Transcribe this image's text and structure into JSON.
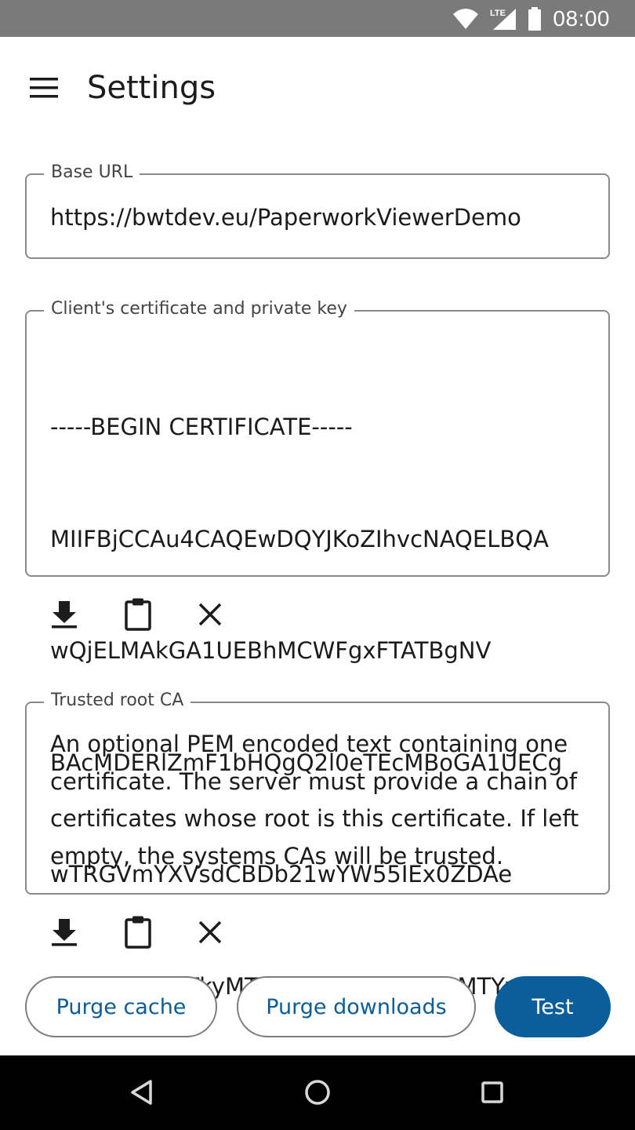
{
  "status_bar": {
    "time": "08:00",
    "icons": [
      "wifi-icon",
      "lte-signal-icon",
      "battery-icon"
    ],
    "lte_label": "LTE"
  },
  "app_bar": {
    "title": "Settings",
    "menu_icon": "menu-icon"
  },
  "base_url": {
    "label": "Base URL",
    "value": "https://bwtdev.eu/PaperworkViewerDemo"
  },
  "client_certificate": {
    "label": "Client's certificate and private key",
    "lines": [
      "-----BEGIN CERTIFICATE-----",
      "MIIFBjCCAu4CAQEwDQYJKoZIhvcNAQELBQA",
      "wQjELMAkGA1UEBhMCWFgxFTATBgNV",
      "BAcMDERlZmF1bHQgQ2l0eTEcMBoGA1UECg",
      "wTRGVmYXVsdCBDb21wYW55IEx0ZDAe",
      "Fw0yMjA5MTkyMTI3NDRaFw0zMjA5MTYyMT"
    ],
    "actions": [
      "download-icon",
      "paste-icon",
      "clear-icon"
    ]
  },
  "trusted_root_ca": {
    "label": "Trusted root CA",
    "placeholder": "An optional PEM encoded text containing one certificate. The server must provide a chain of certificates whose root is this certificate. If left empty, the systems CAs will be trusted.",
    "actions": [
      "download-icon",
      "paste-icon",
      "clear-icon"
    ]
  },
  "buttons": {
    "purge_cache": "Purge cache",
    "purge_downloads": "Purge downloads",
    "test": "Test"
  },
  "colors": {
    "status_bar": "#7a7a7a",
    "accent": "#0b5e99",
    "outline": "#8a8a8a",
    "nav_bar": "#000000"
  },
  "nav_bar": {
    "icons": [
      "back-icon",
      "home-icon",
      "recents-icon"
    ]
  }
}
